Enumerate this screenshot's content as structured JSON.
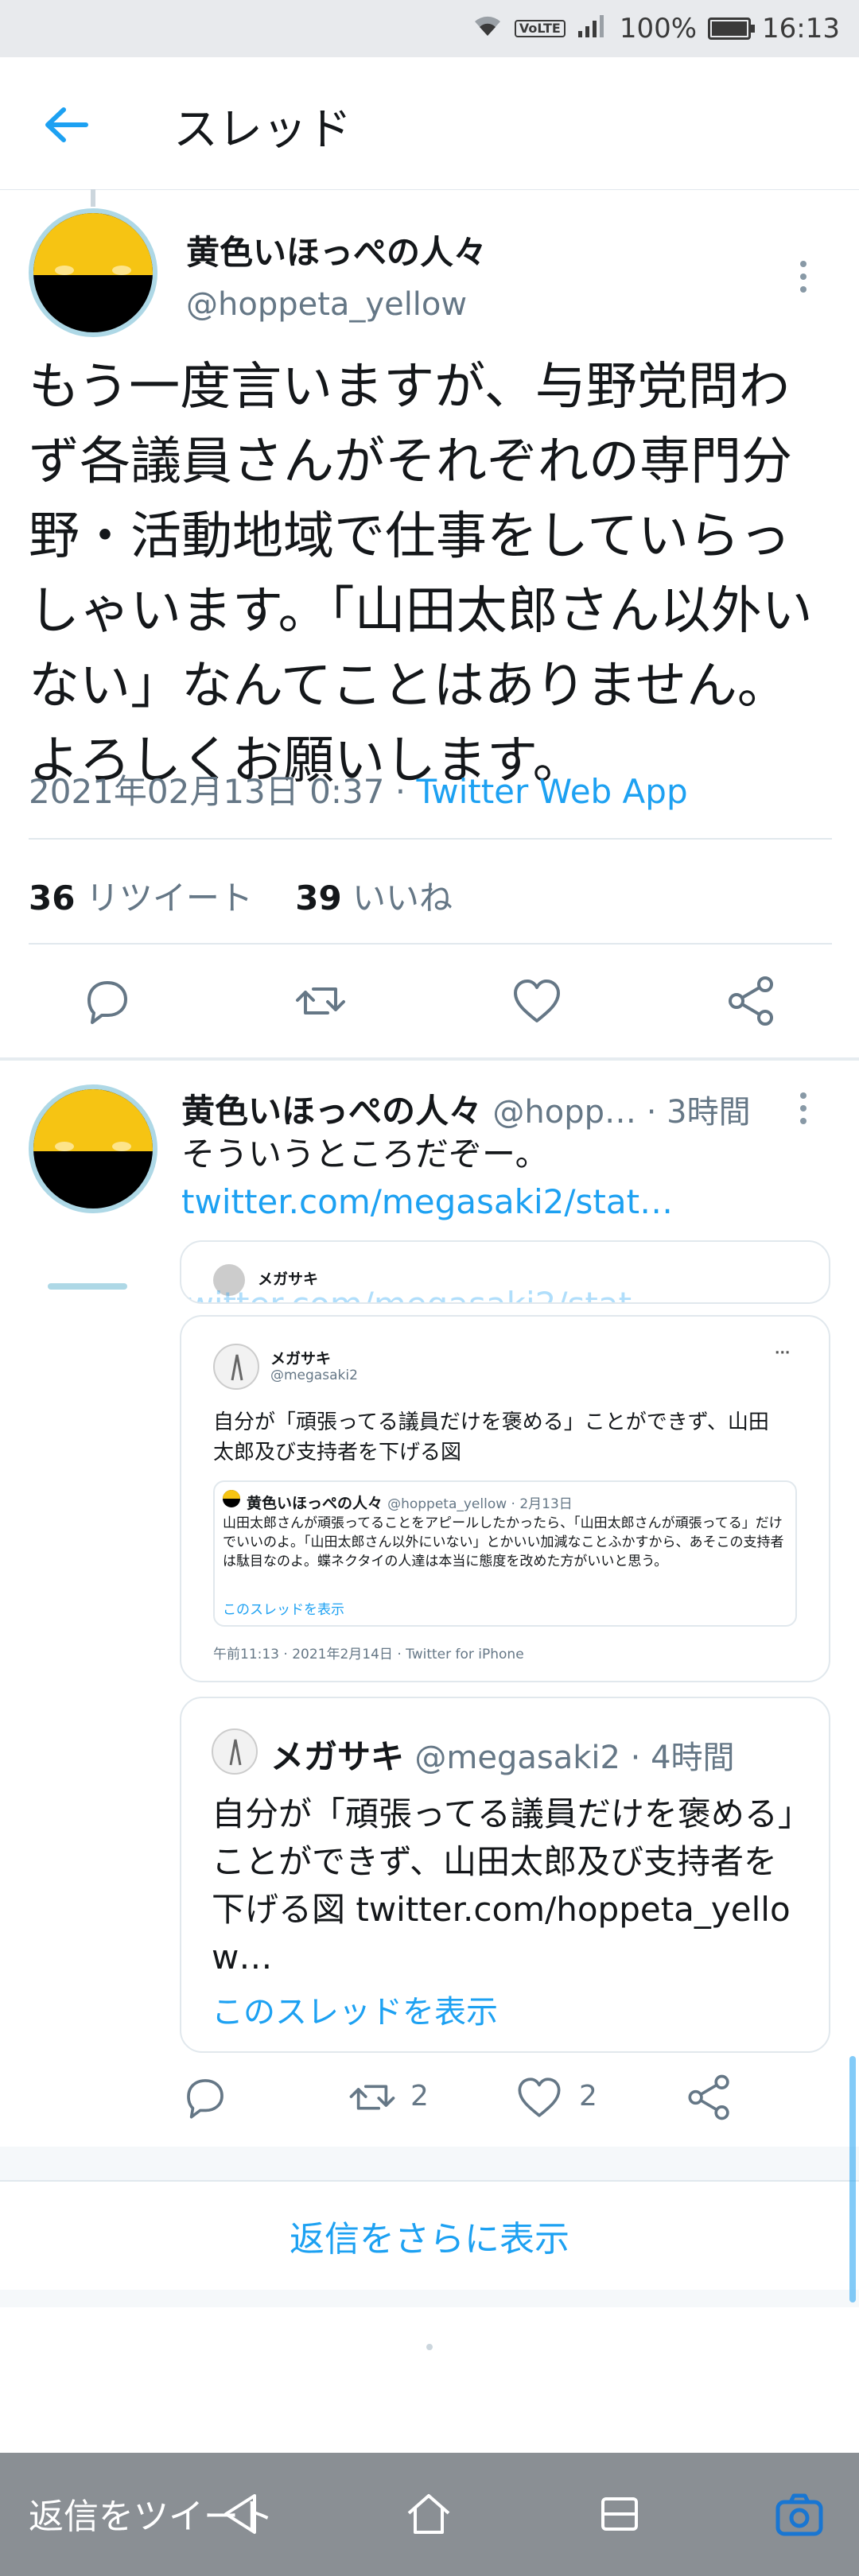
{
  "status_bar": {
    "battery": "100%",
    "time": "16:13",
    "volte": "VoLTE"
  },
  "header": {
    "title": "スレッド"
  },
  "main_tweet": {
    "name": "黄色いほっぺの人々",
    "handle": "@hoppeta_yellow",
    "text": "もう一度言いますが、与野党問わず各議員さんがそれぞれの専門分野・活動地域で仕事をしていらっしゃいます。「山田太郎さん以外いない」なんてことはありません。よろしくお願いします。",
    "timestamp": "2021年02月13日 0:37",
    "separator": " · ",
    "app": "Twitter Web App",
    "retweets": "36",
    "retweets_label": "リツイート",
    "likes": "39",
    "likes_label": "いいね"
  },
  "reply": {
    "name": "黄色いほっぺの人々",
    "handle": "@hopp…",
    "time": " · 3時間",
    "text": "そういうところだぞー。",
    "link": "twitter.com/megasaki2/stat…",
    "behind_card_name": "メガサキ",
    "behind_card_link": "twitter.com/megasaki2/stat…",
    "retweet_count": "2",
    "like_count": "2"
  },
  "screenshot_card": {
    "name": "メガサキ",
    "handle": "@megasaki2",
    "text": "自分が「頑張ってる議員だけを褒める」ことができず、山田太郎及び支持者を下げる図",
    "inner_name": "黄色いほっぺの人々",
    "inner_handle": "@hoppeta_yellow · 2月13日",
    "inner_text": "山田太郎さんが頑張ってることをアピールしたかったら、「山田太郎さんが頑張ってる」だけでいいのよ。「山田太郎さん以外にいない」とかいい加減なことふかすから、あそこの支持者は駄目なのよ。蝶ネクタイの人達は本当に態度を改めた方がいいと思う。",
    "inner_link": "このスレッドを表示",
    "footer": "午前11:13 · 2021年2月14日 · Twitter for iPhone",
    "more": "···"
  },
  "quote_card": {
    "name": "メガサキ",
    "handle": "@megasaki2",
    "time": " · 4時間",
    "text": "自分が「頑張ってる議員だけを褒める」ことができず、山田太郎及び支持者を下げる図 twitter.com/hoppeta_yellow…",
    "show_thread": "このスレッドを表示"
  },
  "show_more_replies": "返信をさらに表示",
  "compose_placeholder": "返信をツイート",
  "colors": {
    "accent": "#1da1f2",
    "avatar_yellow": "#f6c413",
    "text": "#14171a",
    "secondary": "#657786"
  }
}
